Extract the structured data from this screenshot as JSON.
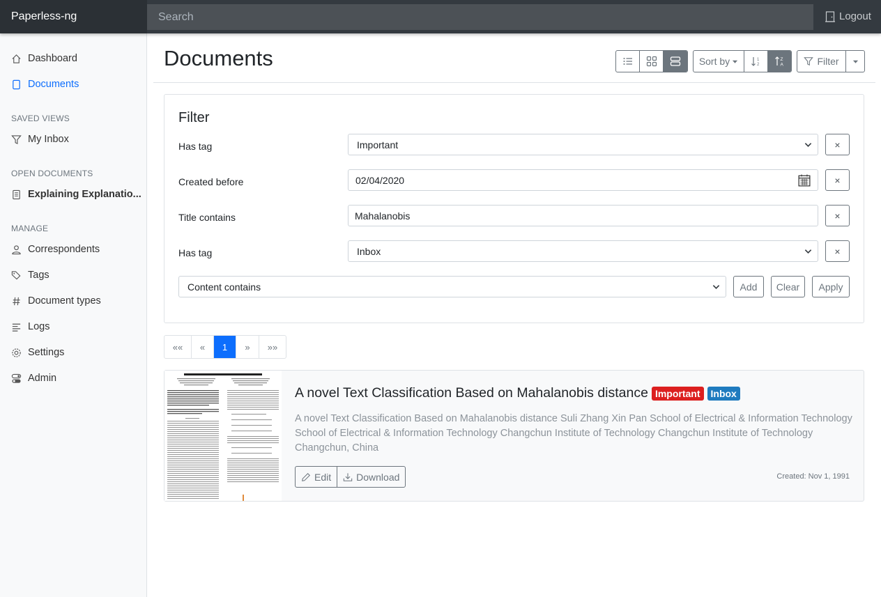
{
  "app": {
    "title": "Paperless-ng"
  },
  "topbar": {
    "search_placeholder": "Search",
    "logout_label": "Logout"
  },
  "sidebar": {
    "main_items": [
      {
        "label": "Dashboard",
        "icon": "house-icon",
        "active": false
      },
      {
        "label": "Documents",
        "icon": "file-icon",
        "active": true
      }
    ],
    "saved_views_heading": "SAVED VIEWS",
    "saved_views": [
      {
        "label": "My Inbox",
        "icon": "funnel-icon"
      }
    ],
    "open_documents_heading": "OPEN DOCUMENTS",
    "open_documents": [
      {
        "label": "Explaining Explanatio...",
        "icon": "file-text-icon"
      }
    ],
    "manage_heading": "MANAGE",
    "manage_items": [
      {
        "label": "Correspondents",
        "icon": "person-icon"
      },
      {
        "label": "Tags",
        "icon": "tags-icon"
      },
      {
        "label": "Document types",
        "icon": "hash-icon"
      },
      {
        "label": "Logs",
        "icon": "text-left-icon"
      },
      {
        "label": "Settings",
        "icon": "gear-icon"
      },
      {
        "label": "Admin",
        "icon": "toggles-icon"
      }
    ]
  },
  "main": {
    "title": "Documents",
    "toolbar": {
      "view_modes": [
        "list-icon",
        "grid-icon",
        "details-icon"
      ],
      "active_view": "details-icon",
      "sort_label": "Sort by",
      "filter_label": "Filter"
    },
    "filter": {
      "title": "Filter",
      "rules": [
        {
          "label": "Has tag",
          "value": "Important",
          "kind": "select"
        },
        {
          "label": "Created before",
          "value": "02/04/2020",
          "kind": "date"
        },
        {
          "label": "Title contains",
          "value": "Mahalanobis",
          "kind": "text"
        },
        {
          "label": "Has tag",
          "value": "Inbox",
          "kind": "select"
        }
      ],
      "new_rule_select": "Content contains",
      "add_label": "Add",
      "clear_label": "Clear",
      "apply_label": "Apply"
    },
    "pagination": {
      "first": "««",
      "prev": "«",
      "current": "1",
      "next": "»",
      "last": "»»"
    },
    "documents": [
      {
        "title": "A novel Text Classification Based on Mahalanobis distance",
        "tags": [
          {
            "label": "Important",
            "color": "#dc1f1f"
          },
          {
            "label": "Inbox",
            "color": "#1f7bbf"
          }
        ],
        "snippet": "A novel Text Classification Based on Mahalanobis distance Suli Zhang Xin Pan School of Electrical & Information Technology School of Electrical & Information Technology Changchun Institute of Technology Changchun Institute of Technology Changchun, China",
        "edit_label": "Edit",
        "download_label": "Download",
        "created": "Created: Nov 1, 1991"
      }
    ]
  },
  "colors": {
    "accent": "#0d6efd",
    "topbar": "#343a40",
    "sidebar": "#f8f9fa"
  }
}
